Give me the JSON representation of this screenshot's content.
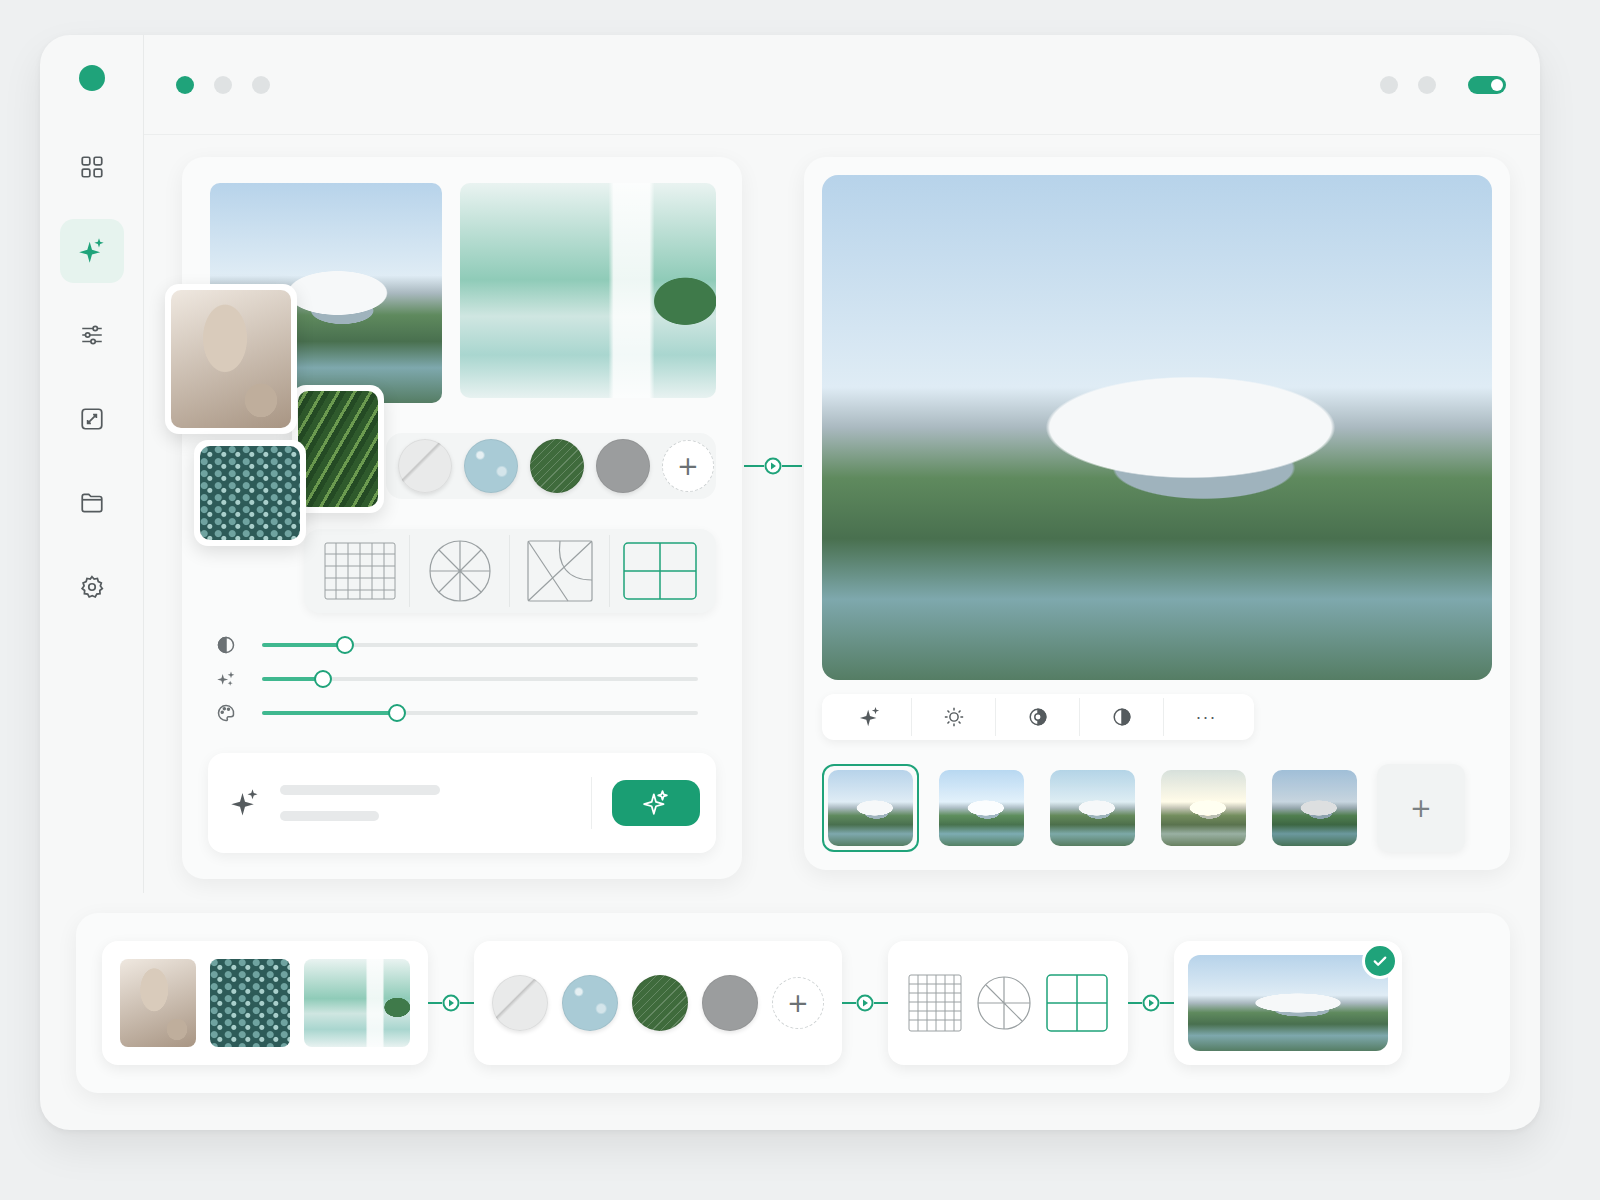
{
  "window": {
    "dots": [
      {
        "color": "#1fa37a"
      },
      {
        "color": "#dfe2e3"
      },
      {
        "color": "#dfe2e3"
      }
    ],
    "right_dots": [
      {
        "color": "#dfe2e3"
      },
      {
        "color": "#dfe2e3"
      }
    ],
    "toggle": {
      "on": true
    }
  },
  "sidebar": {
    "items": [
      {
        "kind": "grid",
        "selected": false
      },
      {
        "kind": "sparkle",
        "selected": true
      },
      {
        "kind": "sliders",
        "selected": false
      },
      {
        "kind": "frame",
        "selected": false
      },
      {
        "kind": "folder",
        "selected": false
      },
      {
        "kind": "gear",
        "selected": false
      }
    ]
  },
  "references": [
    {
      "kind": "building"
    },
    {
      "kind": "interior"
    }
  ],
  "floating_references": [
    {
      "kind": "leaf"
    },
    {
      "kind": "palm"
    },
    {
      "kind": "texture"
    }
  ],
  "materials": {
    "swatches": [
      {
        "color": "#e9eaea"
      },
      {
        "color": "#a9cbd6"
      },
      {
        "color": "#3f6b3c"
      },
      {
        "color": "#9b9d9e"
      }
    ],
    "add": "+"
  },
  "composition": [
    {
      "kind": "grid",
      "selected": false
    },
    {
      "kind": "circle",
      "selected": false
    },
    {
      "kind": "diagonal",
      "selected": false
    },
    {
      "kind": "thirds",
      "selected": true
    }
  ],
  "sliders": [
    {
      "kind": "contrast",
      "level": 0.19
    },
    {
      "kind": "sparkle",
      "level": 0.14
    },
    {
      "kind": "palette",
      "level": 0.31
    }
  ],
  "prompt": {
    "lines": [
      0.55,
      0.34
    ]
  },
  "toolbar": [
    {
      "kind": "sparkle"
    },
    {
      "kind": "sun"
    },
    {
      "kind": "contrast"
    },
    {
      "kind": "half"
    },
    {
      "kind": "more",
      "text": "···"
    }
  ],
  "variations": {
    "items": [
      {
        "selected": true
      },
      {
        "selected": false
      },
      {
        "selected": false
      },
      {
        "selected": false
      },
      {
        "selected": false
      }
    ],
    "add": "+"
  },
  "pipeline": {
    "references": [
      {
        "kind": "leaf"
      },
      {
        "kind": "texture"
      },
      {
        "kind": "interior"
      }
    ],
    "add": "+",
    "composition": [
      {
        "kind": "grid",
        "selected": false
      },
      {
        "kind": "circle",
        "selected": false
      },
      {
        "kind": "thirds",
        "selected": true
      }
    ],
    "result": {
      "approved": true
    }
  }
}
